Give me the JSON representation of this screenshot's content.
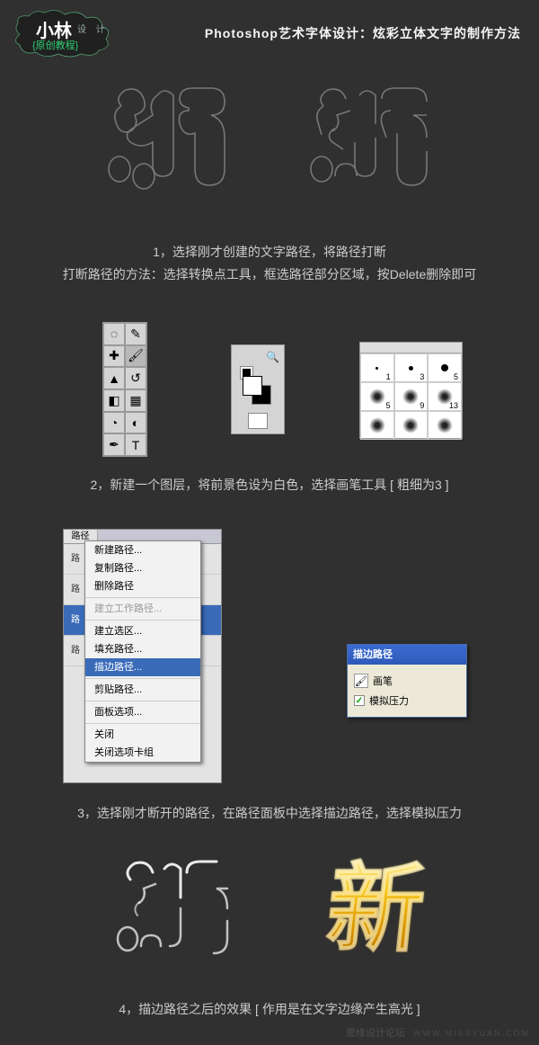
{
  "logo": {
    "main": "小林",
    "sub": "设 计",
    "orig": "{原创教程}"
  },
  "header": "Photoshop艺术字体设计：炫彩立体文字的制作方法",
  "steps": {
    "s1": "1，选择刚才创建的文字路径，将路径打断",
    "s1b": "打断路径的方法：选择转换点工具，框选路径部分区域，按Delete删除即可",
    "s2": "2，新建一个图层，将前景色设为白色，选择画笔工具 [ 粗细为3 ]",
    "s3": "3，选择刚才断开的路径，在路径面板中选择描边路径，选择模拟压力",
    "s4": "4，描边路径之后的效果 [ 作用是在文字边缘产生高光 ]"
  },
  "paths": {
    "tab": "路径",
    "r1": "路",
    "r2": "路",
    "r3": "路",
    "r4": "路"
  },
  "menu": {
    "m1": "新建路径...",
    "m2": "复制路径...",
    "m3": "删除路径",
    "m4": "建立工作路径...",
    "m5": "建立选区...",
    "m6": "填充路径...",
    "m7": "描边路径...",
    "m8": "剪贴路径...",
    "m9": "面板选项...",
    "m10": "关闭",
    "m11": "关闭选项卡组"
  },
  "dialog": {
    "title": "描边路径",
    "brush": "画笔",
    "pressure": "模拟压力",
    "check": "✓"
  },
  "brush": {
    "n1": "1",
    "n3": "3",
    "n5": "5",
    "n5b": "5",
    "n9": "9",
    "n13": "13"
  },
  "footer": {
    "label": "思缘设计论坛",
    "url": "WWW.MISSYUAN.COM"
  }
}
